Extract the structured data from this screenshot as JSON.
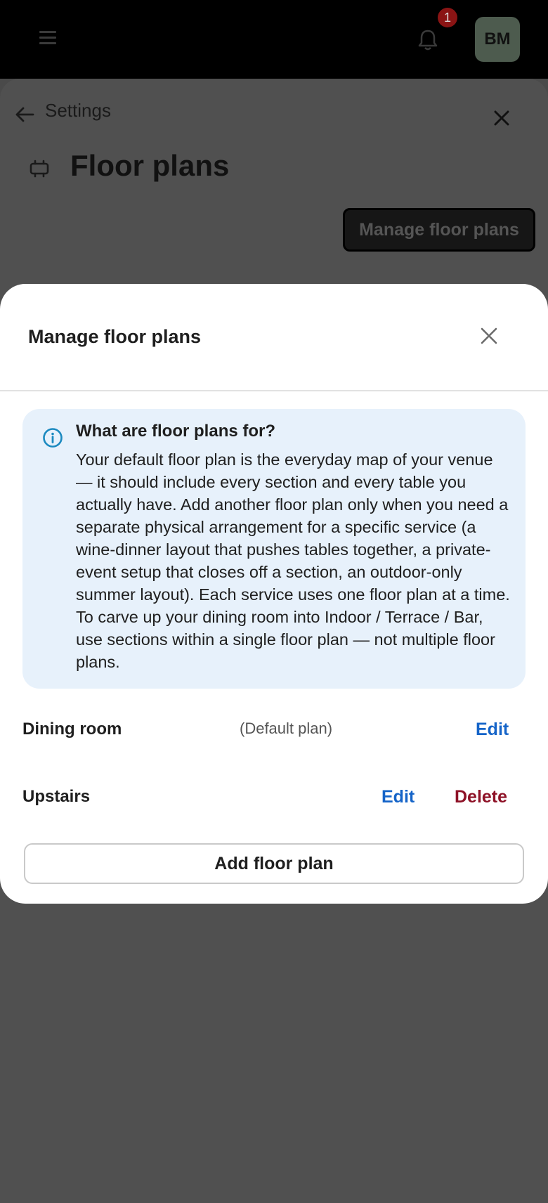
{
  "topbar": {
    "notification_count": "1",
    "avatar_initials": "BM"
  },
  "settings": {
    "back_label": "Settings",
    "title": "Floor plans",
    "manage_button": "Manage floor plans"
  },
  "modal": {
    "title": "Manage floor plans",
    "info": {
      "heading": "What are floor plans for?",
      "body": "Your default floor plan is the everyday map of your venue — it should include every section and every table you actually have. Add another floor plan only when you need a separate physical arrangement for a specific service (a wine-dinner layout that pushes tables together, a private-event setup that closes off a section, an outdoor-only summer layout). Each service uses one floor plan at a time. To carve up your dining room into Indoor / Terrace / Bar, use sections within a single floor plan — not multiple floor plans."
    },
    "plans": [
      {
        "name": "Dining room",
        "note": "(Default plan)",
        "edit": "Edit"
      },
      {
        "name": "Upstairs",
        "edit": "Edit",
        "delete": "Delete"
      }
    ],
    "add_button": "Add floor plan"
  },
  "colors": {
    "link_blue": "#1564c8",
    "delete_red": "#8e1227",
    "info_bg": "#e7f1fb",
    "badge_red": "#8a1414"
  },
  "icons": [
    "menu-icon",
    "bell-icon",
    "back-arrow-icon",
    "close-icon",
    "floor-plan-icon",
    "info-icon"
  ]
}
